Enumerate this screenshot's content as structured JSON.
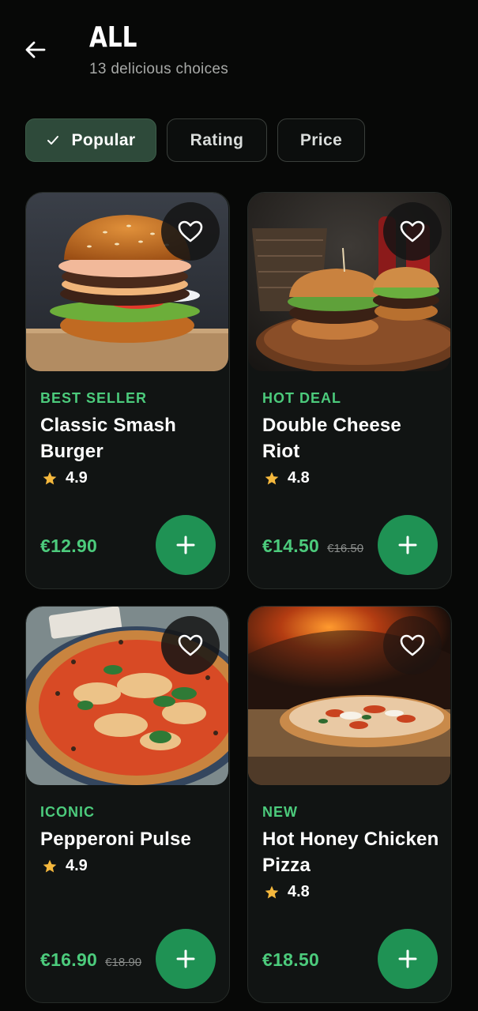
{
  "header": {
    "title": "ALL",
    "subtitle": "13 delicious choices",
    "back_icon": "arrow-left-icon"
  },
  "filters": [
    {
      "label": "Popular",
      "active": true,
      "icon": "check-icon"
    },
    {
      "label": "Rating",
      "active": false
    },
    {
      "label": "Price",
      "active": false
    }
  ],
  "products": [
    {
      "badge": "BEST SELLER",
      "name": "Classic Smash Burger",
      "rating": "4.9",
      "price": "€12.90",
      "old_price": ""
    },
    {
      "badge": "HOT DEAL",
      "name": "Double Cheese Riot",
      "rating": "4.8",
      "price": "€14.50",
      "old_price": "€16.50"
    },
    {
      "badge": "ICONIC",
      "name": "Pepperoni Pulse",
      "rating": "4.9",
      "price": "€16.90",
      "old_price": "€18.90"
    },
    {
      "badge": "NEW",
      "name": "Hot Honey Chicken Pizza",
      "rating": "4.8",
      "price": "€18.50",
      "old_price": ""
    }
  ],
  "colors": {
    "accent": "#1f9254",
    "accent_text": "#4ccb7c",
    "star": "#f5b83d",
    "background": "#070807",
    "card": "#111413"
  },
  "icons": {
    "favorite": "heart-outline-icon",
    "add": "plus-icon",
    "rating": "star-icon"
  }
}
